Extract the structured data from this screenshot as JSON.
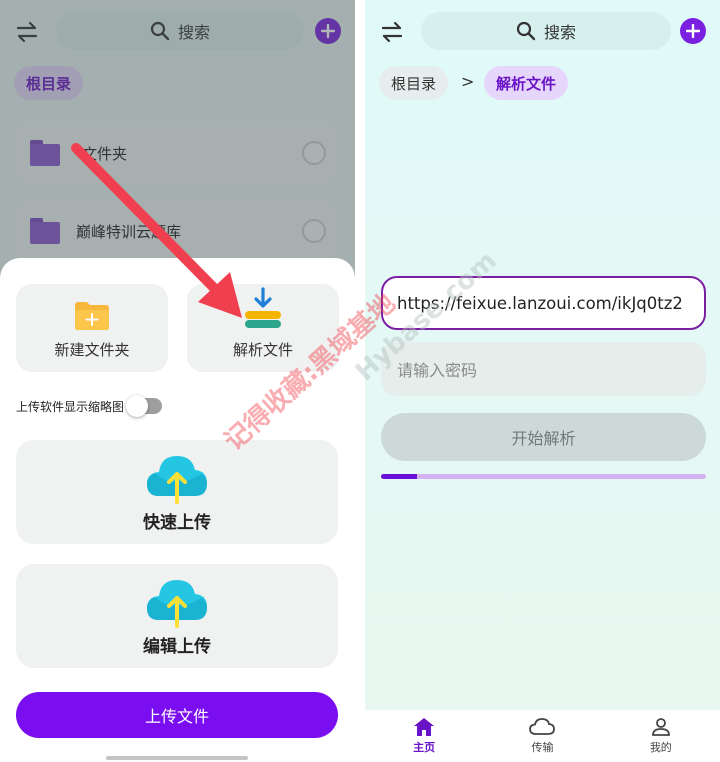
{
  "left": {
    "search_placeholder": "搜索",
    "breadcrumb_root": "根目录",
    "folders": [
      {
        "name": "文件夹"
      },
      {
        "name": "巅峰特训云题库"
      }
    ],
    "sheet": {
      "new_folder": "新建文件夹",
      "parse_file": "解析文件",
      "thumb_toggle_label": "上传软件显示缩略图",
      "thumb_toggle_on": false,
      "quick_upload": "快速上传",
      "edit_upload": "编辑上传",
      "upload_file_button": "上传文件"
    }
  },
  "right": {
    "search_placeholder": "搜索",
    "breadcrumb_root": "根目录",
    "breadcrumb_separator": ">",
    "breadcrumb_current": "解析文件",
    "url_value": "https://feixue.lanzoui.com/ikJq0tz2",
    "password_placeholder": "请输入密码",
    "parse_button": "开始解析",
    "progress": 0.11,
    "nav": [
      {
        "label": "主页",
        "icon": "home-icon",
        "active": true
      },
      {
        "label": "传输",
        "icon": "cloud-icon",
        "active": false
      },
      {
        "label": "我的",
        "icon": "person-icon",
        "active": false
      }
    ]
  },
  "watermark": {
    "text_cn": "记得收藏:黑域基地",
    "text_en": "Hybase.com"
  },
  "colors": {
    "accent": "#7a0ef0",
    "accent_light": "#e6d6fb",
    "url_border": "#7b1fa2",
    "arrow": "#f04050"
  }
}
